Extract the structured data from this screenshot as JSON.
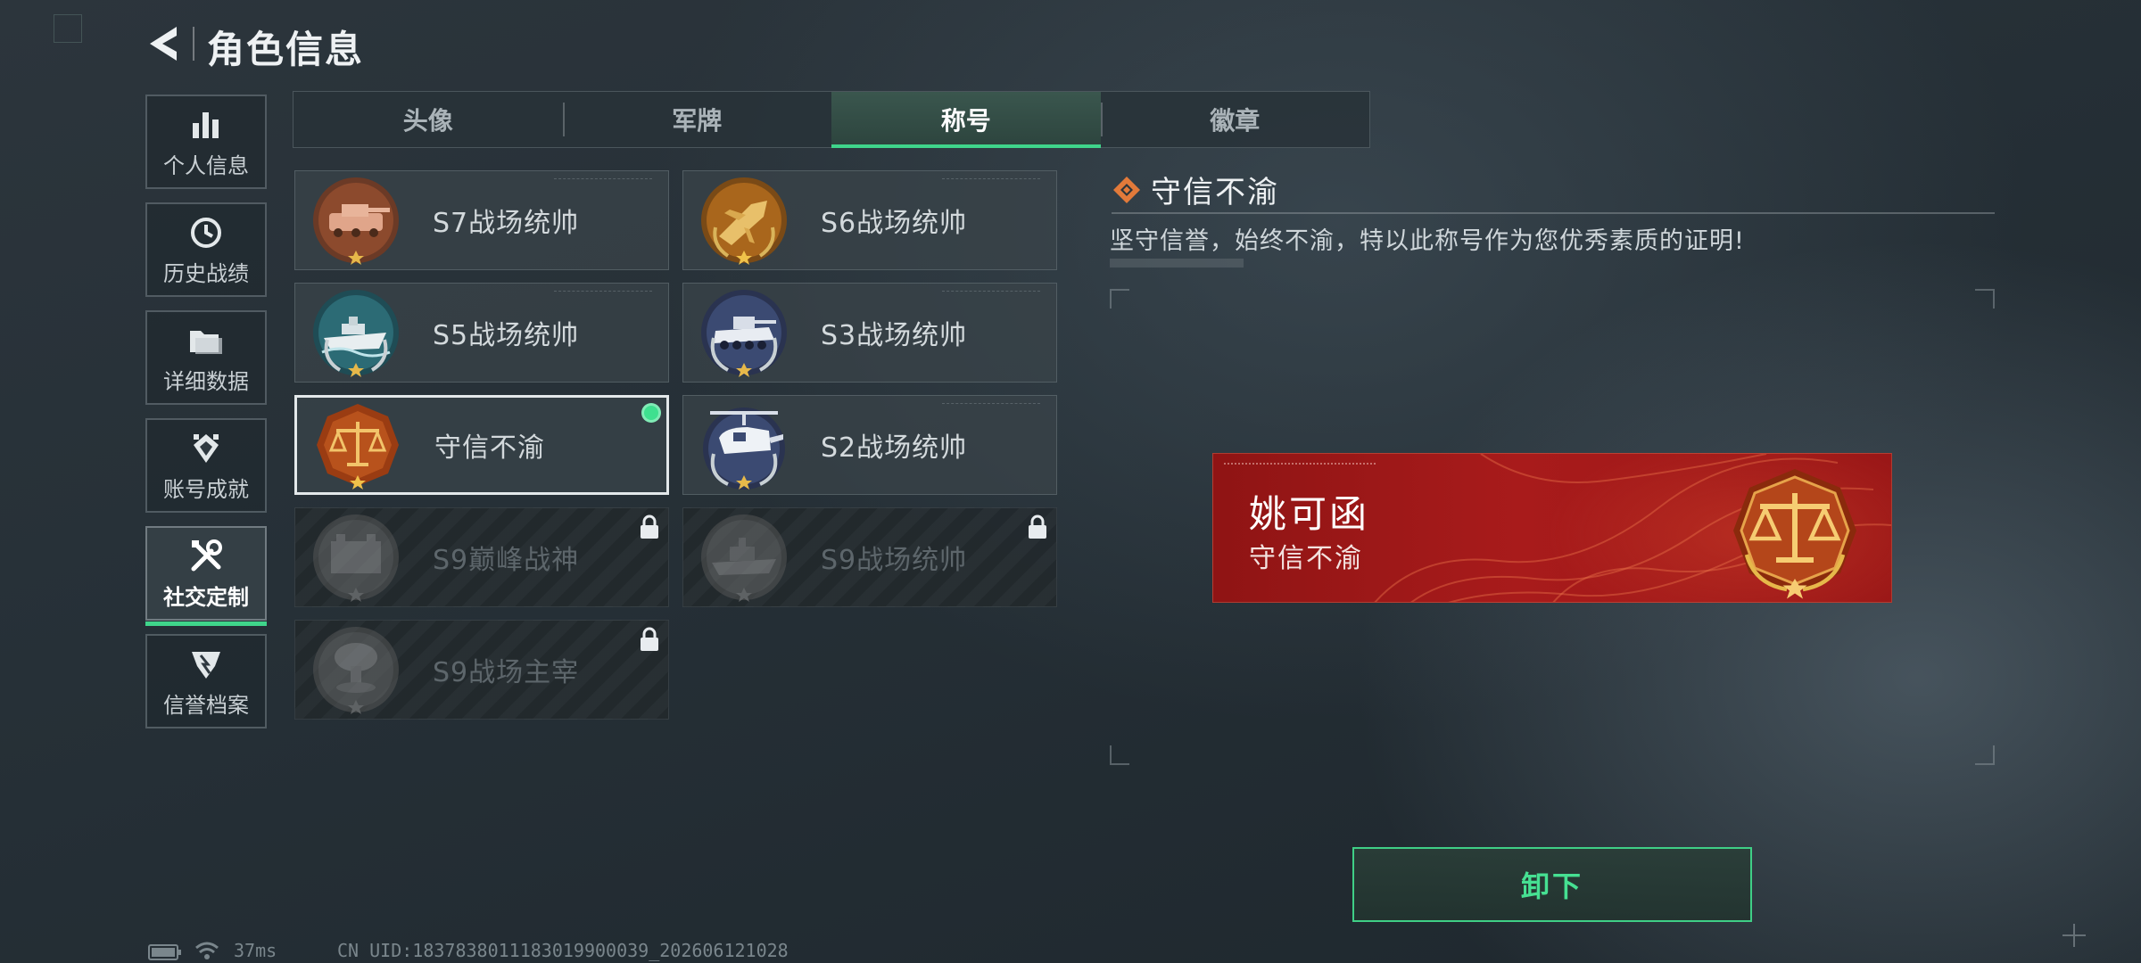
{
  "header": {
    "title": "角色信息"
  },
  "sidebar": {
    "items": [
      {
        "label": "个人信息",
        "icon": "bar-chart-icon",
        "active": false
      },
      {
        "label": "历史战绩",
        "icon": "clock-icon",
        "active": false
      },
      {
        "label": "详细数据",
        "icon": "folder-icon",
        "active": false
      },
      {
        "label": "账号成就",
        "icon": "achievement-icon",
        "active": false
      },
      {
        "label": "社交定制",
        "icon": "tools-icon",
        "active": true
      },
      {
        "label": "信誉档案",
        "icon": "badge-icon",
        "active": false
      }
    ]
  },
  "tabs": [
    {
      "label": "头像",
      "active": false
    },
    {
      "label": "军牌",
      "active": false
    },
    {
      "label": "称号",
      "active": true
    },
    {
      "label": "徽章",
      "active": false
    }
  ],
  "titles": [
    {
      "name": "S7战场统帅",
      "state": "unlocked",
      "medal": "tank-medal-icon"
    },
    {
      "name": "S6战场统帅",
      "state": "unlocked",
      "medal": "jet-medal-icon"
    },
    {
      "name": "S5战场统帅",
      "state": "unlocked",
      "medal": "boat-medal-icon"
    },
    {
      "name": "S3战场统帅",
      "state": "unlocked",
      "medal": "apc-medal-icon"
    },
    {
      "name": "守信不渝",
      "state": "equipped",
      "medal": "scales-medal-icon"
    },
    {
      "name": "S2战场统帅",
      "state": "unlocked",
      "medal": "helicopter-medal-icon"
    },
    {
      "name": "S9巅峰战神",
      "state": "locked",
      "medal": "fortress-medal-icon"
    },
    {
      "name": "S9战场统帅",
      "state": "locked",
      "medal": "ship-medal-icon"
    },
    {
      "name": "S9战场主宰",
      "state": "locked",
      "medal": "mushroom-cloud-medal-icon"
    }
  ],
  "detail": {
    "title": "守信不渝",
    "description": "坚守信誉，始终不渝，特以此称号作为您优秀素质的证明!"
  },
  "nameplate": {
    "player_name": "姚可函",
    "title": "守信不渝"
  },
  "unequip_button": {
    "label": "卸下"
  },
  "status_bar": {
    "ping": "37ms",
    "uid": "CN UID:1837838011183019900039_202606121028"
  },
  "colors": {
    "accent_green": "#3fd58b",
    "nameplate_red": "#a81b1b",
    "medal_bronze": "#c8782e"
  }
}
